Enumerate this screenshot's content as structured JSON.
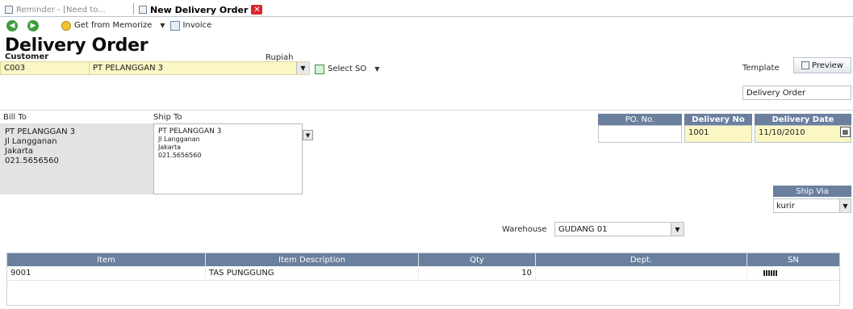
{
  "tabs": [
    {
      "label": "Reminder - [Need to..."
    },
    {
      "label": "New Delivery Order",
      "close": "✕"
    }
  ],
  "toolbar": {
    "memorize_label": "Get from Memorize",
    "invoice_label": "Invoice"
  },
  "title": "Delivery Order",
  "customer": {
    "label": "Customer",
    "code": "C003",
    "name": "PT PELANGGAN 3",
    "currency_label": "Rupiah",
    "select_so_label": "Select SO"
  },
  "template": {
    "label": "Template",
    "preview_label": "Preview",
    "value": "Delivery Order"
  },
  "bill_to": {
    "label": "Bill To",
    "lines": [
      "PT PELANGGAN 3",
      "Jl Langganan",
      "Jakarta",
      "021.5656560"
    ]
  },
  "ship_to": {
    "label": "Ship To",
    "lines": [
      "PT PELANGGAN 3",
      "Jl Langganan",
      "Jakarta",
      "021.5656560"
    ]
  },
  "header_fields": {
    "po_label": "PO. No.",
    "po_value": "",
    "delivery_no_label": "Delivery No",
    "delivery_no_value": "1001",
    "delivery_date_label": "Delivery Date",
    "delivery_date_value": "11/10/2010"
  },
  "ship_via": {
    "label": "Ship Via",
    "value": "kurir"
  },
  "warehouse": {
    "label": "Warehouse",
    "value": "GUDANG 01"
  },
  "items_table": {
    "columns": [
      "Item",
      "Item Description",
      "Qty",
      "Dept.",
      "SN"
    ],
    "rows": [
      {
        "item": "9001",
        "description": "TAS PUNGGUNG",
        "qty": "10",
        "dept": ""
      }
    ]
  },
  "colors": {
    "header_blue": "#6b7f9e",
    "field_yellow": "#fbf7c4",
    "close_red": "#d8262a",
    "nav_green": "#3f9d3a"
  }
}
